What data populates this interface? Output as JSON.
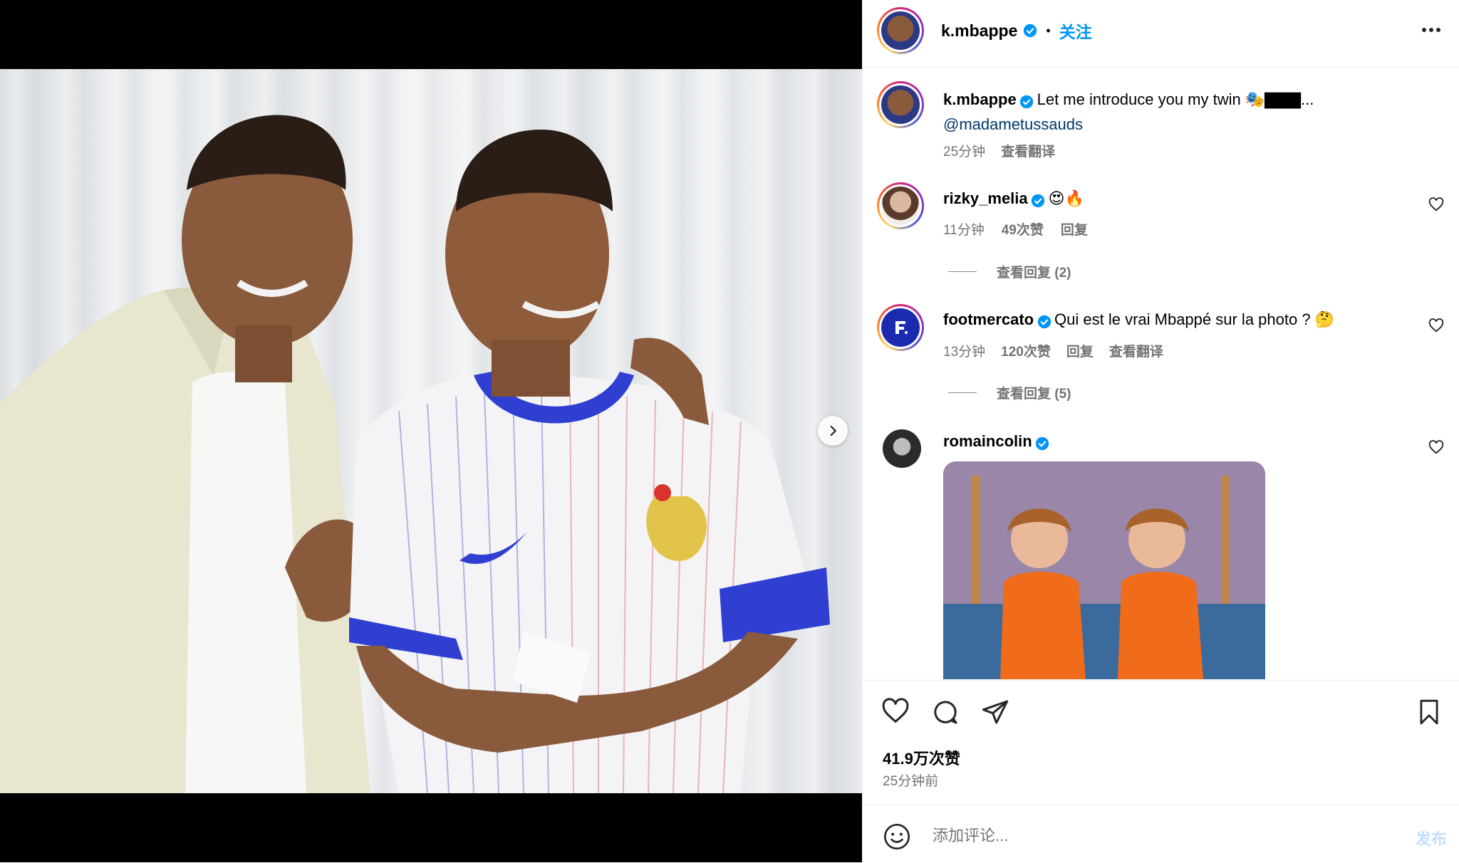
{
  "post": {
    "author": "k.mbappe",
    "follow_label": "关注",
    "more_icon": "more-horizontal-icon",
    "separator": "•"
  },
  "caption": {
    "username": "k.mbappe",
    "text": "Let me introduce you my twin 🎭▇▇▇...",
    "mention": "@madametussauds",
    "time": "25分钟",
    "translate": "查看翻译"
  },
  "comments": [
    {
      "username": "rizky_melia",
      "text": "😍🔥",
      "time": "11分钟",
      "likes": "49次赞",
      "reply": "回复",
      "view_replies": "查看回复 (2)"
    },
    {
      "username": "footmercato",
      "text": "Qui est le vrai Mbappé sur la photo ? 🤔",
      "time": "13分钟",
      "likes": "120次赞",
      "reply": "回复",
      "translate": "查看翻译",
      "view_replies": "查看回复 (5)"
    },
    {
      "username": "romaincolin",
      "text": ""
    }
  ],
  "stats": {
    "likes": "41.9万次赞",
    "time": "25分钟前"
  },
  "add_comment": {
    "placeholder": "添加评论...",
    "post_label": "发布"
  },
  "colors": {
    "accent": "#0095f6",
    "verified": "#0095f6",
    "muted": "#737373",
    "post_disabled": "#c0dffd"
  },
  "carousel": {
    "total": 5,
    "active": 1
  }
}
